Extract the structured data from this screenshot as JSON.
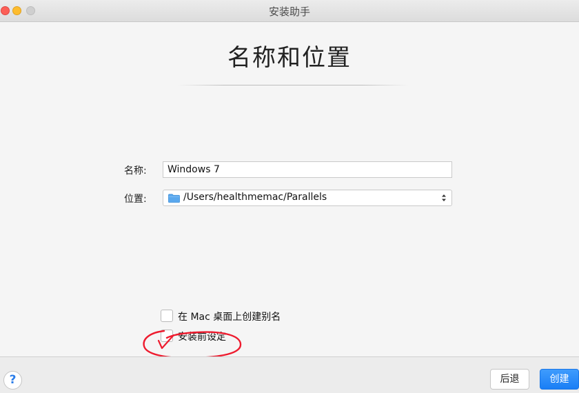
{
  "window": {
    "title": "安装助手"
  },
  "page": {
    "title": "名称和位置"
  },
  "form": {
    "name_label": "名称:",
    "name_value": "Windows 7",
    "location_label": "位置:",
    "location_value": "/Users/healthmemac/Parallels"
  },
  "options": {
    "alias_label": "在 Mac 桌面上创建别名",
    "alias_checked": false,
    "settings_label": "安装前设定",
    "settings_checked": false
  },
  "footer": {
    "help_label": "?",
    "back_label": "后退",
    "create_label": "创建"
  },
  "colors": {
    "accent": "#1a7ef5",
    "annotation": "#ee1b2e",
    "folder": "#5aa8ee"
  }
}
